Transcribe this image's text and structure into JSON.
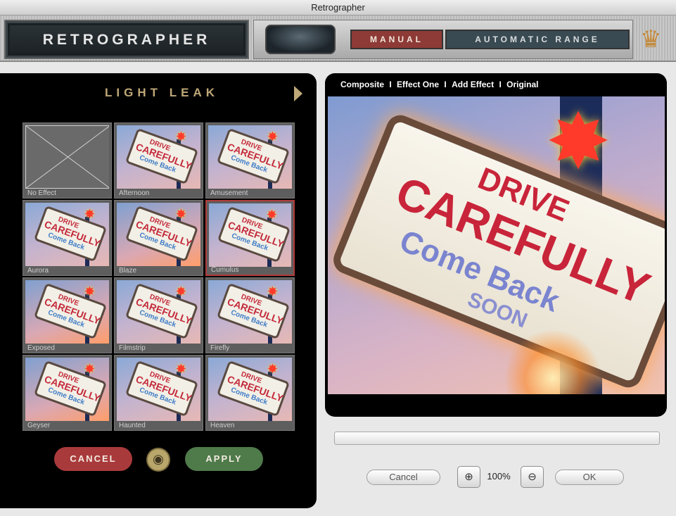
{
  "window": {
    "title": "Retrographer"
  },
  "header": {
    "logo_text": "RETROGRAPHER",
    "modes": [
      {
        "label": "MANUAL",
        "active": true
      },
      {
        "label": "AUTOMATIC RANGE",
        "active": false
      }
    ],
    "crown_icon": "crown-icon"
  },
  "effects_panel": {
    "title": "LIGHT LEAK",
    "next_icon": "triangle-right-icon",
    "thumbnails": [
      {
        "label": "No Effect"
      },
      {
        "label": "Afternoon"
      },
      {
        "label": "Amusement"
      },
      {
        "label": "Aurora"
      },
      {
        "label": "Blaze"
      },
      {
        "label": "Cumulus",
        "selected": true
      },
      {
        "label": "Exposed"
      },
      {
        "label": "Filmstrip"
      },
      {
        "label": "Firefly"
      },
      {
        "label": "Geyser"
      },
      {
        "label": "Haunted"
      },
      {
        "label": "Heaven"
      }
    ],
    "cancel_label": "CANCEL",
    "apply_label": "APPLY",
    "eye_icon": "eye-icon"
  },
  "sign_text": {
    "line1": "DRIVE",
    "line2": "CAREFULLY",
    "line3": "Come Back",
    "line4": "SOON"
  },
  "preview": {
    "tabs": [
      "Composite",
      "Effect One",
      "Add Effect",
      "Original"
    ],
    "separator": "I"
  },
  "progress": {
    "value": 0
  },
  "controls": {
    "cancel_label": "Cancel",
    "ok_label": "OK",
    "zoom_in_icon": "zoom-in-icon",
    "zoom_out_icon": "zoom-out-icon",
    "zoom_level": "100%"
  },
  "colors": {
    "manual_active": "#8e3a36",
    "cancel_pill": "#a93a3c",
    "apply_pill": "#4f7a4a",
    "selected_border": "#b23a3a",
    "title_gold": "#bfa878"
  }
}
